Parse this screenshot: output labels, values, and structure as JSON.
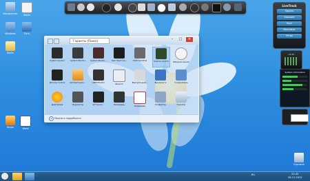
{
  "desktop": {
    "icons": [
      {
        "label": "Компьютер"
      },
      {
        "label": "Файл"
      },
      {
        "label": "Windows"
      },
      {
        "label": "Сеть"
      },
      {
        "label": "Файл"
      },
      {
        "label": "Skype"
      },
      {
        "label": "Word"
      }
    ],
    "recycle_label": "Корзина"
  },
  "dock": {
    "icons": [
      "folder-icon",
      "person-icon",
      "stop-icon",
      "music-icon",
      "system-icon",
      "photo-icon",
      "clock-icon",
      "info-icon",
      "monitor-icon",
      "globe-icon",
      "ball-icon",
      "settings-icon",
      "terminal-icon",
      "tools-icon"
    ]
  },
  "gallery": {
    "search_placeholder": "Гаджеты (Поиск)",
    "controls": {
      "minimize": "–",
      "maximize": "□",
      "close": "×"
    },
    "gadgets": [
      {
        "name": "System Control"
      },
      {
        "name": "System Monitor"
      },
      {
        "name": "System Monito..."
      },
      {
        "name": "Sam Криптоп..."
      },
      {
        "name": "Vista CalcMina"
      },
      {
        "name": "Volume Control"
      },
      {
        "name": "Wikipedia Search"
      },
      {
        "name": "Winamp Control"
      },
      {
        "name": "Автоматическ..."
      },
      {
        "name": "AIMP Monitor"
      },
      {
        "name": "Валюта"
      },
      {
        "name": "Виртуальный..."
      },
      {
        "name": "Выключить"
      },
      {
        "name": "Головоломка"
      },
      {
        "name": "Диаграмма"
      },
      {
        "name": "Индикатор"
      },
      {
        "name": "Источник..."
      },
      {
        "name": "Календарь"
      },
      {
        "name": "Календарь"
      },
      {
        "name": "Конвертер"
      },
      {
        "name": "Корзина"
      }
    ],
    "details_label": "Показать подробности"
  },
  "radio_gadget": {
    "title": "LiveTrack",
    "stations": [
      "Европа",
      "Хорошее",
      "Rock",
      "Максимум",
      "Ретро"
    ]
  },
  "clock_gadget": {
    "time": "22:45"
  },
  "sysinfo_gadget": {
    "title": "System information",
    "bars": [
      0.6,
      0.35,
      0.8,
      0.45
    ]
  },
  "taskbar": {
    "tray_text": "RU",
    "clock_time": "22:45",
    "clock_date": "26.11.2012"
  }
}
